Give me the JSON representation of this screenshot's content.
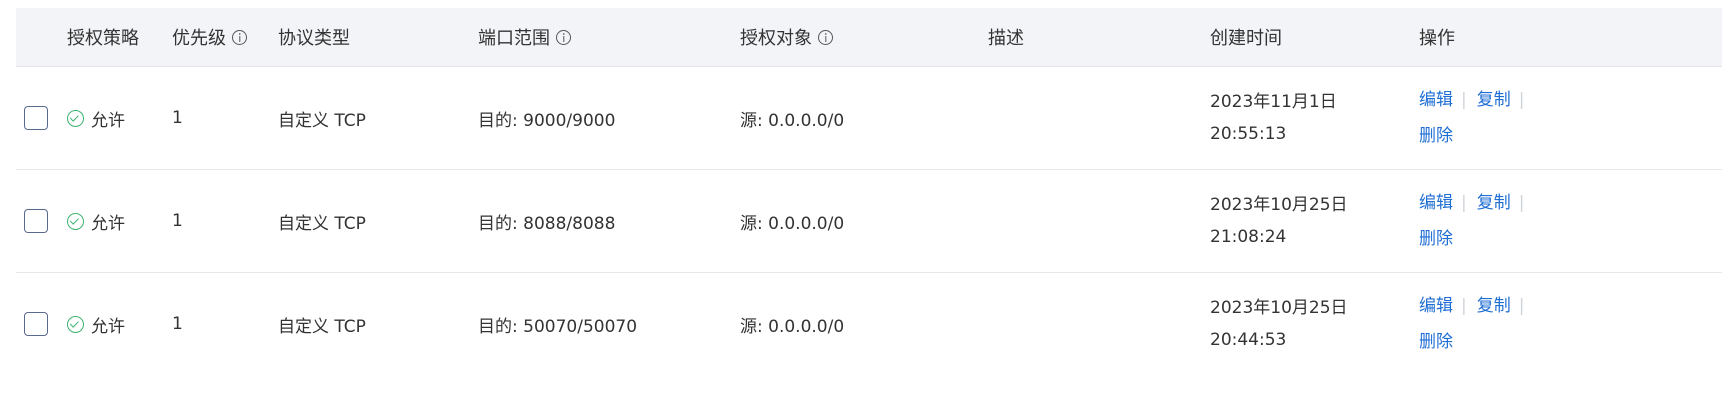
{
  "header": {
    "policy": "授权策略",
    "priority": "优先级",
    "protocol": "协议类型",
    "port_range": "端口范围",
    "target": "授权对象",
    "description": "描述",
    "created": "创建时间",
    "actions": "操作"
  },
  "rows": [
    {
      "policy": "允许",
      "priority": "1",
      "protocol": "自定义 TCP",
      "port": "目的: 9000/9000",
      "source": "源: 0.0.0.0/0",
      "description": "",
      "date": "2023年11月1日",
      "time": "20:55:13",
      "edit": "编辑",
      "copy": "复制",
      "delete": "删除"
    },
    {
      "policy": "允许",
      "priority": "1",
      "protocol": "自定义 TCP",
      "port": "目的: 8088/8088",
      "source": "源: 0.0.0.0/0",
      "description": "",
      "date": "2023年10月25日",
      "time": "21:08:24",
      "edit": "编辑",
      "copy": "复制",
      "delete": "删除"
    },
    {
      "policy": "允许",
      "priority": "1",
      "protocol": "自定义 TCP",
      "port": "目的: 50070/50070",
      "source": "源: 0.0.0.0/0",
      "description": "",
      "date": "2023年10月25日",
      "time": "20:44:53",
      "edit": "编辑",
      "copy": "复制",
      "delete": "删除"
    }
  ],
  "separator": "|",
  "icons": {
    "info": "info-circle-icon",
    "allow": "check-circle-icon"
  },
  "colors": {
    "header_bg": "#f3f4f8",
    "link": "#1f6ed4",
    "allow_green": "#3cb371"
  }
}
